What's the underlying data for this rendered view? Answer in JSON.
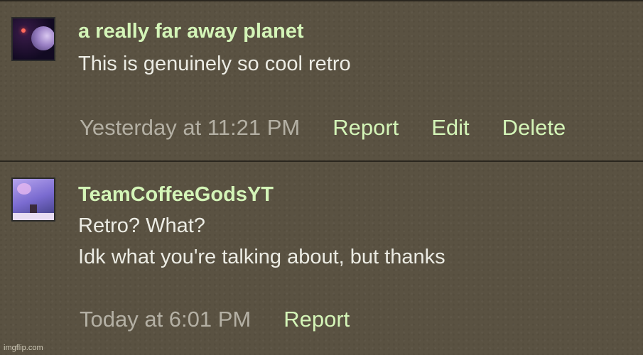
{
  "comments": [
    {
      "username": "a really far away planet",
      "lines": [
        "This is genuinely so cool retro"
      ],
      "timestamp": "Yesterday at 11:21 PM",
      "actions": [
        "Report",
        "Edit",
        "Delete"
      ],
      "avatar_icon": "planet-avatar-icon"
    },
    {
      "username": "TeamCoffeeGodsYT",
      "lines": [
        "Retro? What?",
        "Idk what you're talking about, but thanks"
      ],
      "timestamp": "Today at 6:01 PM",
      "actions": [
        "Report"
      ],
      "avatar_icon": "scene-avatar-icon"
    }
  ],
  "watermark": "imgflip.com",
  "colors": {
    "background": "#5a5242",
    "username": "#d4f5b8",
    "text": "#ecece4",
    "timestamp": "#b4b0a4",
    "divider": "#2b271f"
  }
}
